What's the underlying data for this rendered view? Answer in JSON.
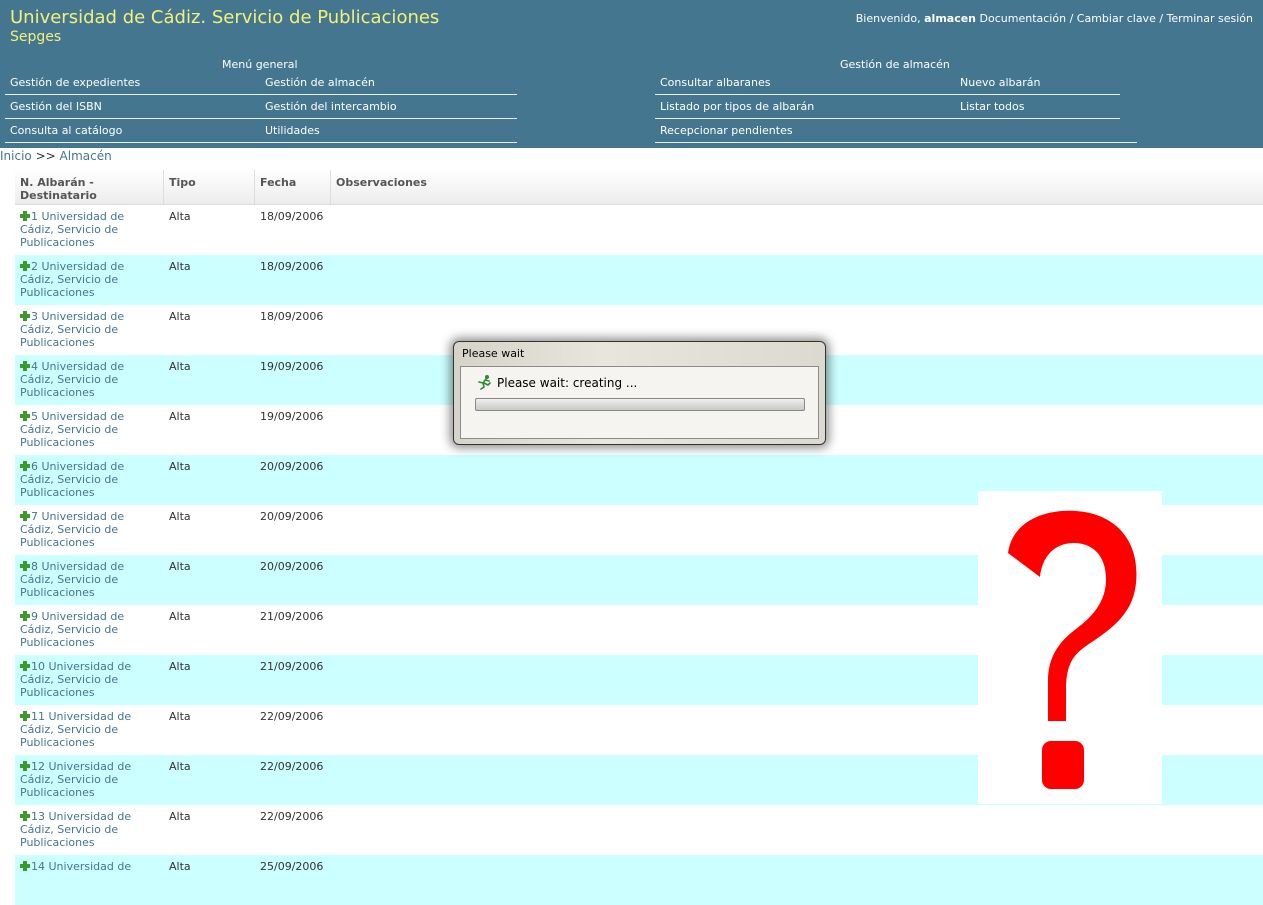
{
  "header": {
    "title": "Universidad de Cádiz. Servicio de Publicaciones",
    "subtitle": "Sepges",
    "welcome": "Bienvenido, ",
    "username": "almacen",
    "links": [
      "Documentación",
      "Cambiar clave",
      "Terminar sesión"
    ],
    "separator": "/"
  },
  "menu_general": {
    "title": "Menú general",
    "items": [
      "Gestión de expedientes",
      "Gestión de almacén",
      "Gestión del ISBN",
      "Gestión del intercambio",
      "Consulta al catálogo",
      "Utilidades"
    ]
  },
  "menu_almacen": {
    "title": "Gestión de almacén",
    "items": [
      "Consultar albaranes",
      "Nuevo albarán",
      "Listado por tipos de albarán",
      "Listar todos",
      "Recepcionar pendientes"
    ]
  },
  "breadcrumb": {
    "home": "Inicio",
    "sep": ">>",
    "current": "Almacén"
  },
  "table": {
    "headers": [
      "N. Albarán - Destinatario",
      "Tipo",
      "Fecha",
      "Observaciones"
    ],
    "rows": [
      {
        "num": "1",
        "dest": "Universidad de Cádiz, Servicio de Publicaciones",
        "tipo": "Alta",
        "fecha": "18/09/2006"
      },
      {
        "num": "2",
        "dest": "Universidad de Cádiz, Servicio de Publicaciones",
        "tipo": "Alta",
        "fecha": "18/09/2006"
      },
      {
        "num": "3",
        "dest": "Universidad de Cádiz, Servicio de Publicaciones",
        "tipo": "Alta",
        "fecha": "18/09/2006"
      },
      {
        "num": "4",
        "dest": "Universidad de Cádiz, Servicio de Publicaciones",
        "tipo": "Alta",
        "fecha": "19/09/2006"
      },
      {
        "num": "5",
        "dest": "Universidad de Cádiz, Servicio de Publicaciones",
        "tipo": "Alta",
        "fecha": "19/09/2006"
      },
      {
        "num": "6",
        "dest": "Universidad de Cádiz, Servicio de Publicaciones",
        "tipo": "Alta",
        "fecha": "20/09/2006"
      },
      {
        "num": "7",
        "dest": "Universidad de Cádiz, Servicio de Publicaciones",
        "tipo": "Alta",
        "fecha": "20/09/2006"
      },
      {
        "num": "8",
        "dest": "Universidad de Cádiz, Servicio de Publicaciones",
        "tipo": "Alta",
        "fecha": "20/09/2006"
      },
      {
        "num": "9",
        "dest": "Universidad de Cádiz, Servicio de Publicaciones",
        "tipo": "Alta",
        "fecha": "21/09/2006"
      },
      {
        "num": "10",
        "dest": "Universidad de Cádiz, Servicio de Publicaciones",
        "tipo": "Alta",
        "fecha": "21/09/2006"
      },
      {
        "num": "11",
        "dest": "Universidad de Cádiz, Servicio de Publicaciones",
        "tipo": "Alta",
        "fecha": "22/09/2006"
      },
      {
        "num": "12",
        "dest": "Universidad de Cádiz, Servicio de Publicaciones",
        "tipo": "Alta",
        "fecha": "22/09/2006"
      },
      {
        "num": "13",
        "dest": "Universidad de Cádiz, Servicio de Publicaciones",
        "tipo": "Alta",
        "fecha": "22/09/2006"
      },
      {
        "num": "14",
        "dest": "Universidad de",
        "tipo": "Alta",
        "fecha": "25/09/2006"
      }
    ]
  },
  "dialog": {
    "title": "Please wait",
    "message": "Please wait: creating ...",
    "icon": "running-man-icon"
  },
  "overlay": {
    "symbol": "question-mark-icon",
    "color": "#ff0000"
  },
  "colors": {
    "header_bg": "#44768f",
    "title": "#f4f17a",
    "row_alt": "#ccffff",
    "link": "#44768f"
  }
}
